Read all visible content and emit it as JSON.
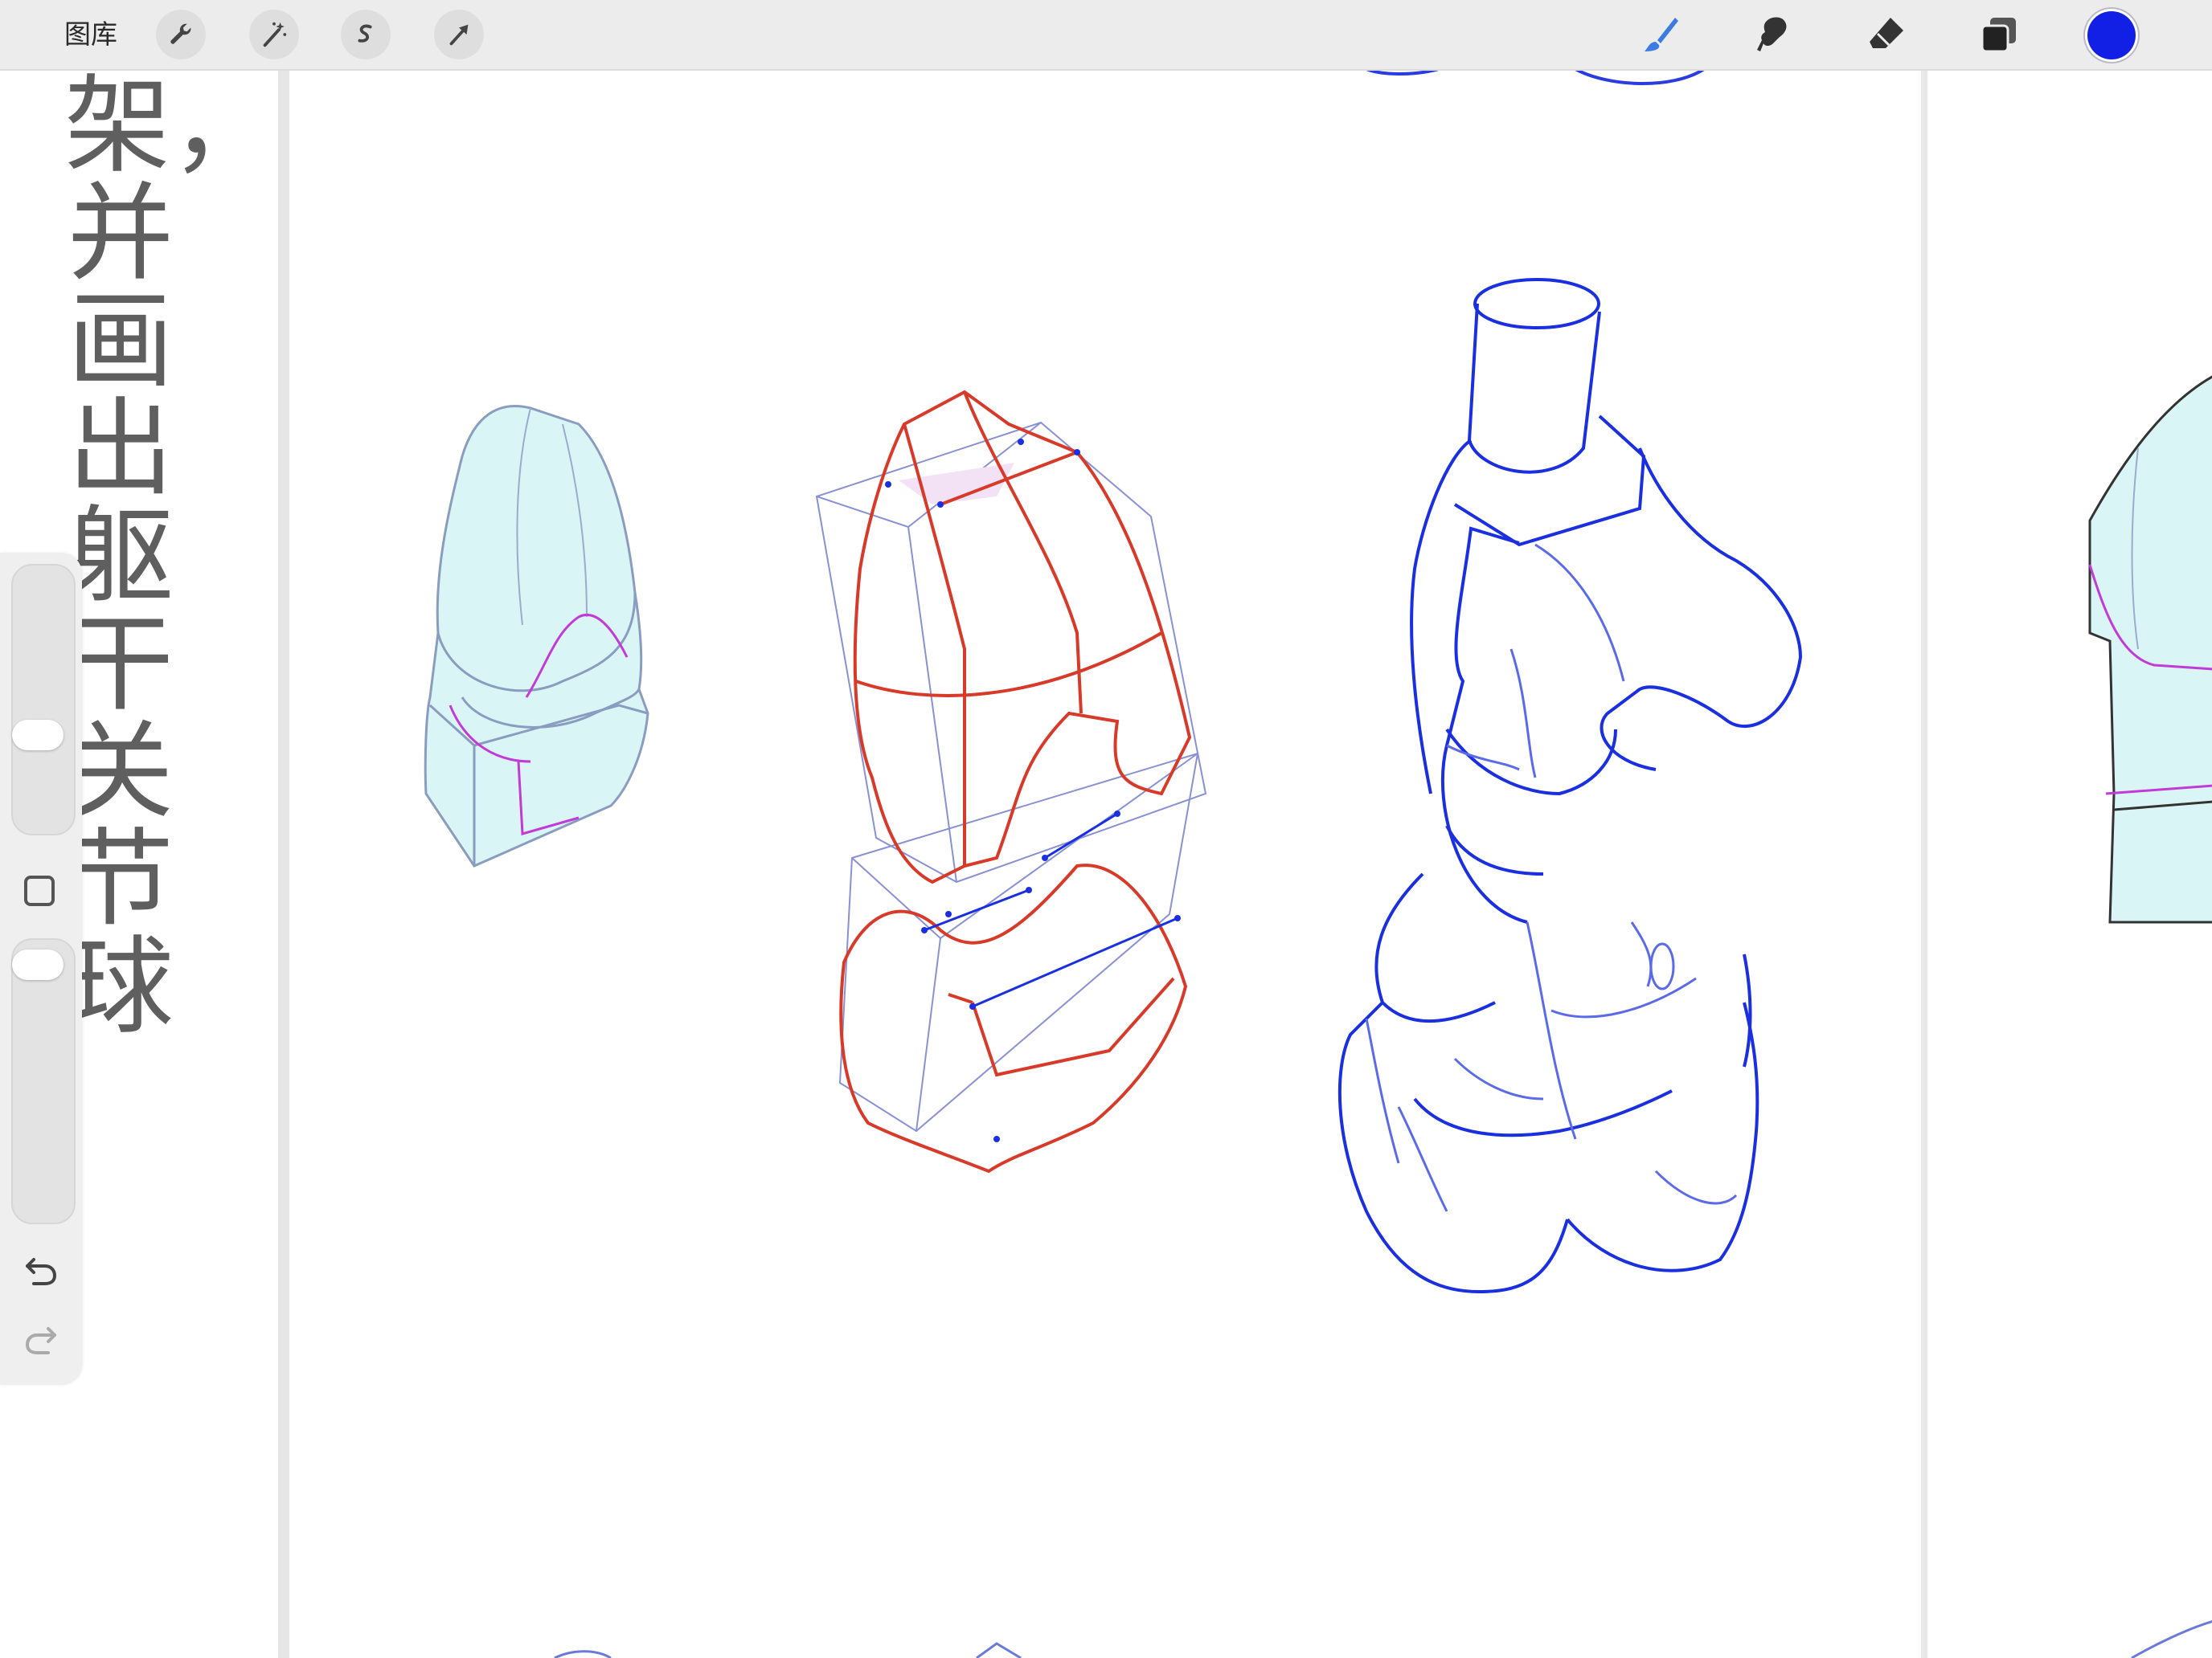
{
  "toolbar": {
    "gallery_label": "图库",
    "left_tools": [
      "wrench-icon",
      "magic-wand-icon",
      "selection-icon",
      "transform-arrow-icon"
    ],
    "right_tools": [
      "brush-icon",
      "smudge-icon",
      "eraser-icon",
      "layers-icon"
    ],
    "current_color": "#1220e6"
  },
  "canvas": {
    "vertical_text": "架，并画出躯干关节球",
    "stroke_colors": {
      "red": "#d83a2a",
      "blue": "#1a2fe0",
      "light_blue": "#5a6ae8",
      "grey_blue": "#8891d4",
      "magenta": "#c23ad8",
      "cyan_fill": "#d9f5f5"
    }
  },
  "sidebar": {
    "brush_size_level": 0.62,
    "opacity_level": 0.95,
    "icons": [
      "modify-square-icon",
      "undo-icon",
      "redo-icon"
    ]
  }
}
